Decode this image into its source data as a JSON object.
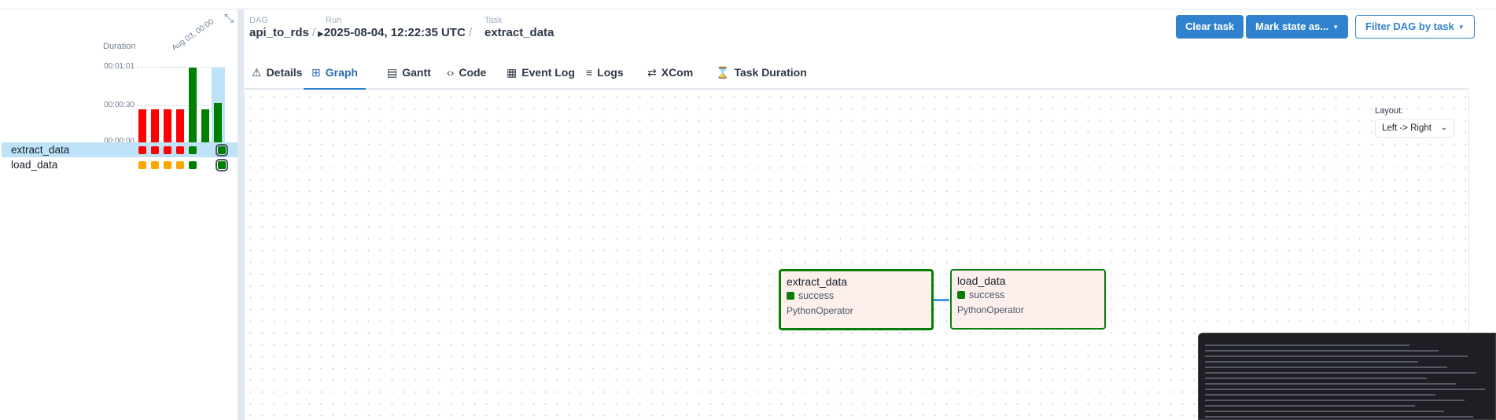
{
  "left_panel": {
    "collapse_icon": "compress-arrows-icon",
    "duration_title": "Duration",
    "y_labels": [
      "00:01:01",
      "00:00:30",
      "00:00:00"
    ],
    "date_label": "Aug 03, 00:00",
    "bar_durations_seconds": [
      30,
      30,
      30,
      30,
      61,
      30,
      35
    ],
    "bar_states": [
      "failed",
      "failed",
      "failed",
      "failed",
      "success",
      "success",
      "success"
    ],
    "tasks": [
      {
        "name": "extract_data",
        "selected": true,
        "states": [
          "failed",
          "failed",
          "failed",
          "failed",
          "success",
          "success"
        ]
      },
      {
        "name": "load_data",
        "selected": false,
        "states": [
          "upstream_failed",
          "upstream_failed",
          "upstream_failed",
          "upstream_failed",
          "success",
          "success"
        ]
      }
    ],
    "colors": {
      "failed": "#ff0000",
      "success": "#008000",
      "upstream_failed": "#ffa500"
    }
  },
  "breadcrumb": {
    "dag_label": "DAG",
    "dag_value": "api_to_rds",
    "run_label": "Run",
    "run_value": "2025-08-04, 12:22:35 UTC",
    "task_label": "Task",
    "task_value": "extract_data",
    "separator": "/"
  },
  "actions": {
    "clear_task": "Clear task",
    "mark_state": "Mark state as...",
    "filter_dag": "Filter DAG by task"
  },
  "tabs": [
    {
      "label": "Details",
      "icon": "warning-icon",
      "glyph": "⚠"
    },
    {
      "label": "Graph",
      "icon": "graph-icon",
      "glyph": "⊞",
      "active": true
    },
    {
      "label": "Gantt",
      "icon": "gantt-icon",
      "glyph": "▤"
    },
    {
      "label": "Code",
      "icon": "code-icon",
      "glyph": "‹›"
    },
    {
      "label": "Event Log",
      "icon": "calendar-icon",
      "glyph": "▦"
    },
    {
      "label": "Logs",
      "icon": "list-icon",
      "glyph": "≡"
    },
    {
      "label": "XCom",
      "icon": "exchange-icon",
      "glyph": "⇄"
    },
    {
      "label": "Task Duration",
      "icon": "hourglass-icon",
      "glyph": "⌛"
    }
  ],
  "graph": {
    "layout_label": "Layout:",
    "layout_value": "Left -> Right",
    "nodes": [
      {
        "name": "extract_data",
        "state": "success",
        "operator": "PythonOperator",
        "selected": true
      },
      {
        "name": "load_data",
        "state": "success",
        "operator": "PythonOperator",
        "selected": false
      }
    ]
  }
}
